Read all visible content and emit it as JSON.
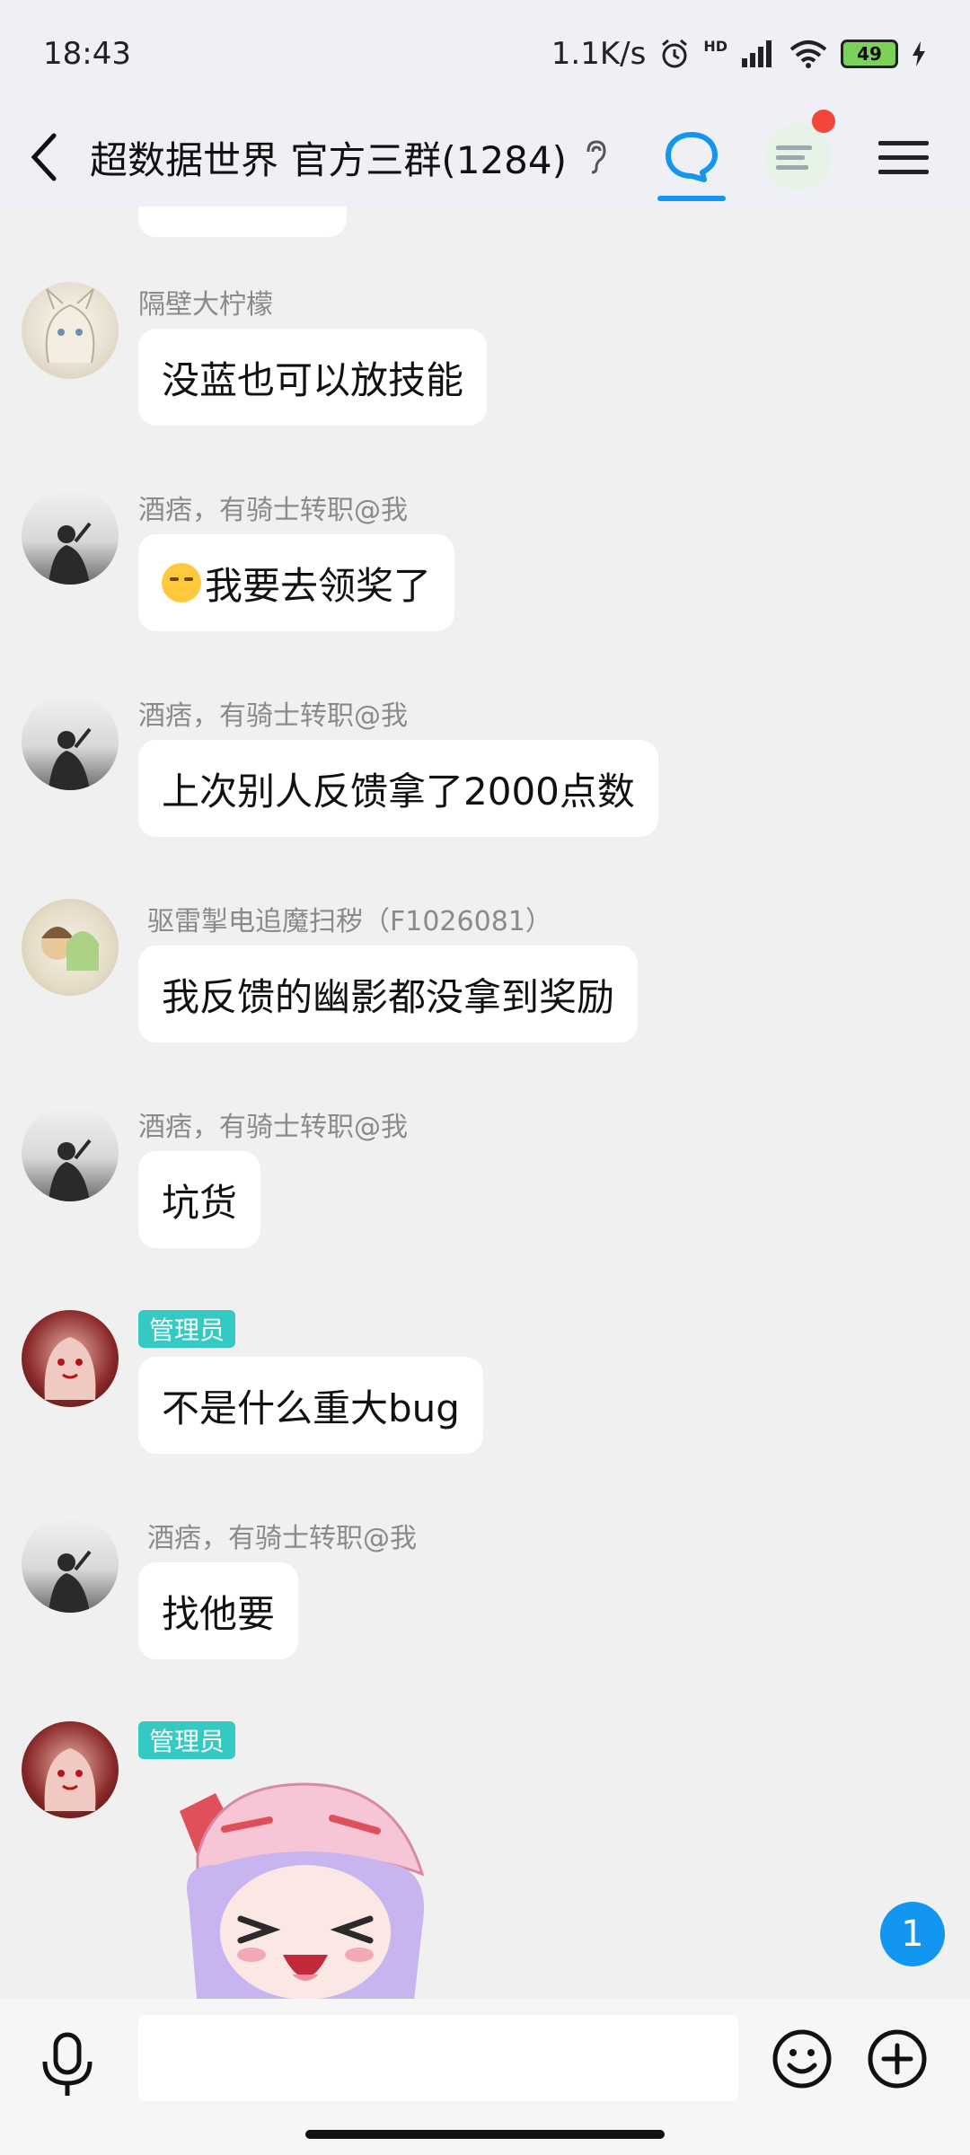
{
  "status_bar": {
    "time": "18:43",
    "net_speed": "1.1K/s",
    "battery": "49",
    "hd_label": "HD"
  },
  "header": {
    "title": "超数据世界 官方三群(1284)"
  },
  "messages": [
    {
      "type": "text",
      "sender": "隔壁大柠檬",
      "text": "没蓝也可以放技能"
    },
    {
      "type": "text",
      "sender": "酒痞，有骑士转职@我",
      "text": "我要去领奖了",
      "emoji": "smirk-emoji"
    },
    {
      "type": "text",
      "sender": "酒痞，有骑士转职@我",
      "text": "上次别人反馈拿了2000点数"
    },
    {
      "type": "text",
      "sender": "驱雷掣电追魔扫秽（F1026081）",
      "text": "我反馈的幽影都没拿到奖励"
    },
    {
      "type": "text",
      "sender": "酒痞，有骑士转职@我",
      "text": "坑货"
    },
    {
      "type": "text",
      "badge": "管理员",
      "text": "不是什么重大bug"
    },
    {
      "type": "text",
      "sender": "酒痞，有骑士转职@我",
      "text": "找他要"
    },
    {
      "type": "sticker",
      "badge": "管理员",
      "sticker": "chibi-girl-sticker"
    }
  ],
  "unread_count": "1",
  "input": {
    "value": "",
    "placeholder": ""
  },
  "colors": {
    "accent": "#1296f0",
    "admin_badge": "#35c9c3",
    "notification": "#f2463a"
  }
}
